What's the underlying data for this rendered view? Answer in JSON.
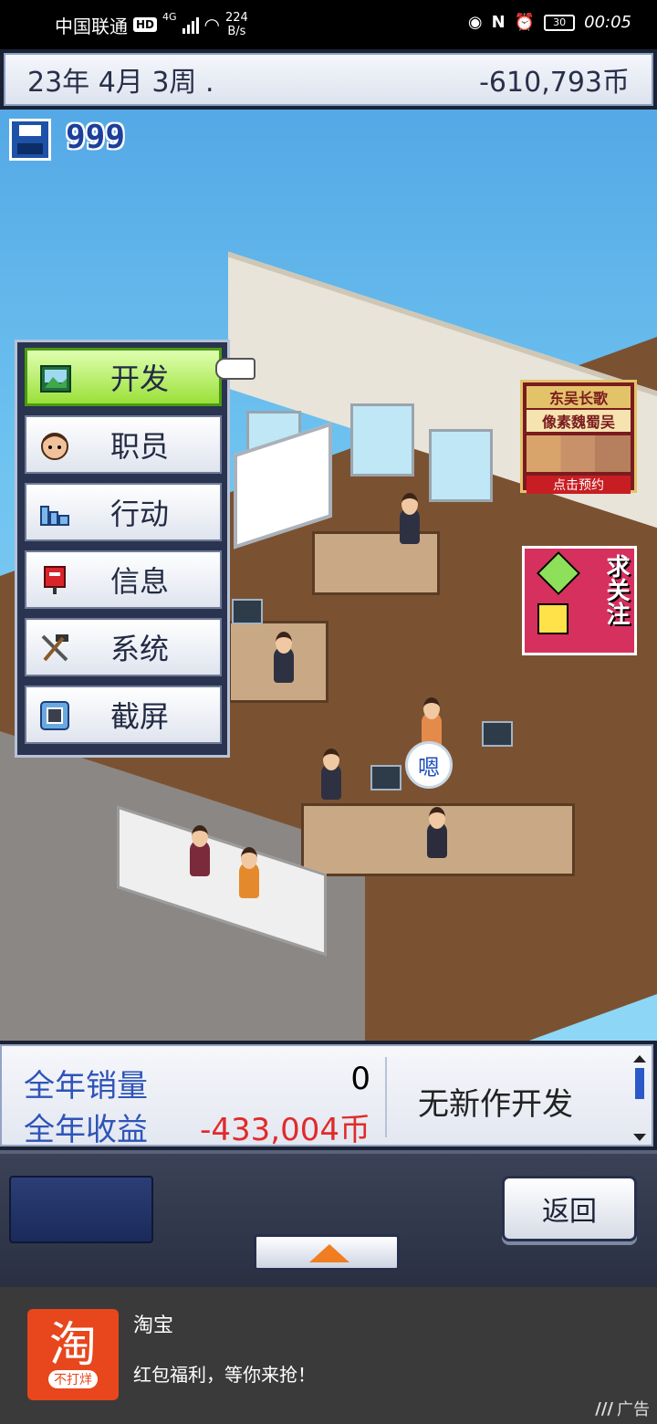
{
  "statusbar": {
    "carrier": "中国联通",
    "hd": "HD",
    "network": "4G",
    "speed_value": "224",
    "speed_unit": "B/s",
    "battery": "30",
    "time": "00:05"
  },
  "topbar": {
    "date": "23年 4月 3周 .",
    "funds": "-610,793币"
  },
  "scene": {
    "save_count": "999",
    "speech": "嗯"
  },
  "menu": {
    "items": [
      {
        "label": "开发",
        "icon": "landscape-icon",
        "active": true
      },
      {
        "label": "职员",
        "icon": "person-icon",
        "active": false
      },
      {
        "label": "行动",
        "icon": "buildings-icon",
        "active": false
      },
      {
        "label": "信息",
        "icon": "mailbox-icon",
        "active": false
      },
      {
        "label": "系统",
        "icon": "tools-icon",
        "active": false
      },
      {
        "label": "截屏",
        "icon": "screenshot-icon",
        "active": false
      }
    ]
  },
  "ads": {
    "ad1": {
      "line1": "东吴长歌",
      "line2": "像素魏蜀吴",
      "line3": "点击预约"
    },
    "ad2": {
      "text": "求关注"
    }
  },
  "info": {
    "annual_sales_label": "全年销量",
    "annual_sales_value": "0",
    "annual_revenue_label": "全年收益",
    "annual_revenue_value": "-433,004币",
    "status": "无新作开发"
  },
  "controls": {
    "back_label": "返回"
  },
  "banner": {
    "logo_char": "淘",
    "logo_tag": "不打烊",
    "title": "淘宝",
    "text": "红包福利，等你来抢！",
    "ad_label": "广告"
  },
  "colors": {
    "negative": "#e02b2b",
    "label_blue": "#2f54b9",
    "active_green": "#9be039"
  }
}
